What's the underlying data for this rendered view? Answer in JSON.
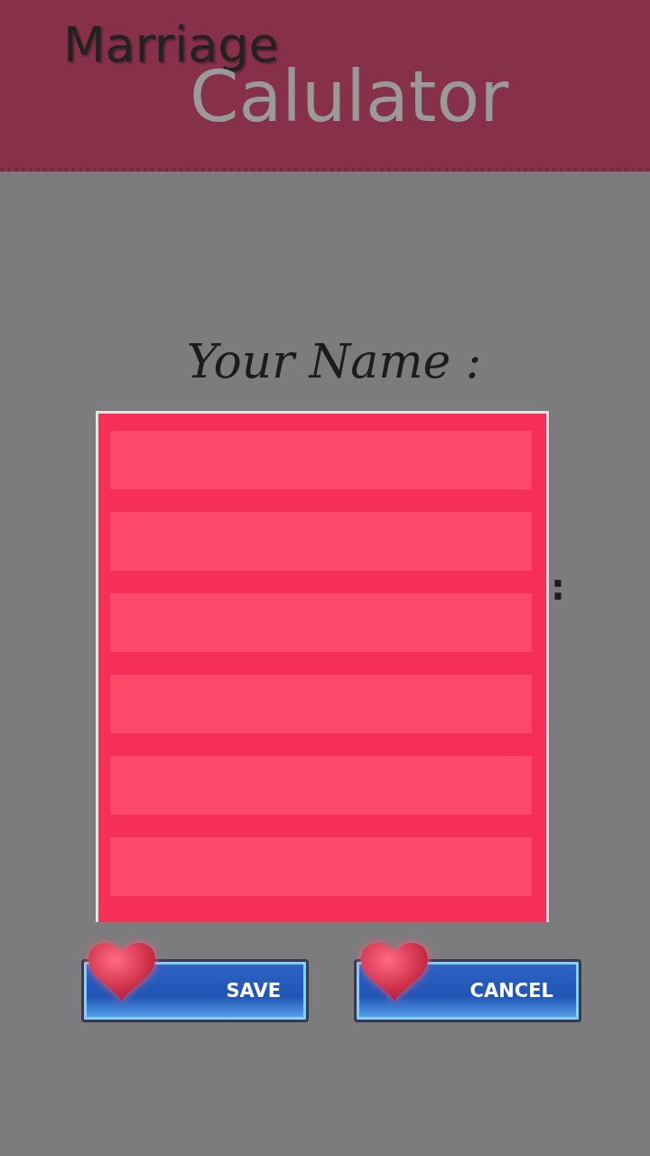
{
  "header": {
    "title_line_1": "Marriage",
    "title_line_2": "Calulator"
  },
  "form": {
    "name_label": "Your Name :",
    "second_label_visible": ":"
  },
  "picker": {
    "options": [
      {
        "kind": "blank"
      },
      {
        "kind": "blank"
      },
      {
        "kind": "blank"
      },
      {
        "kind": "blank"
      },
      {
        "kind": "blank"
      },
      {
        "kind": "blank"
      }
    ]
  },
  "buttons": [
    {
      "label": "SAVE"
    },
    {
      "label": "CANCEL"
    }
  ]
}
